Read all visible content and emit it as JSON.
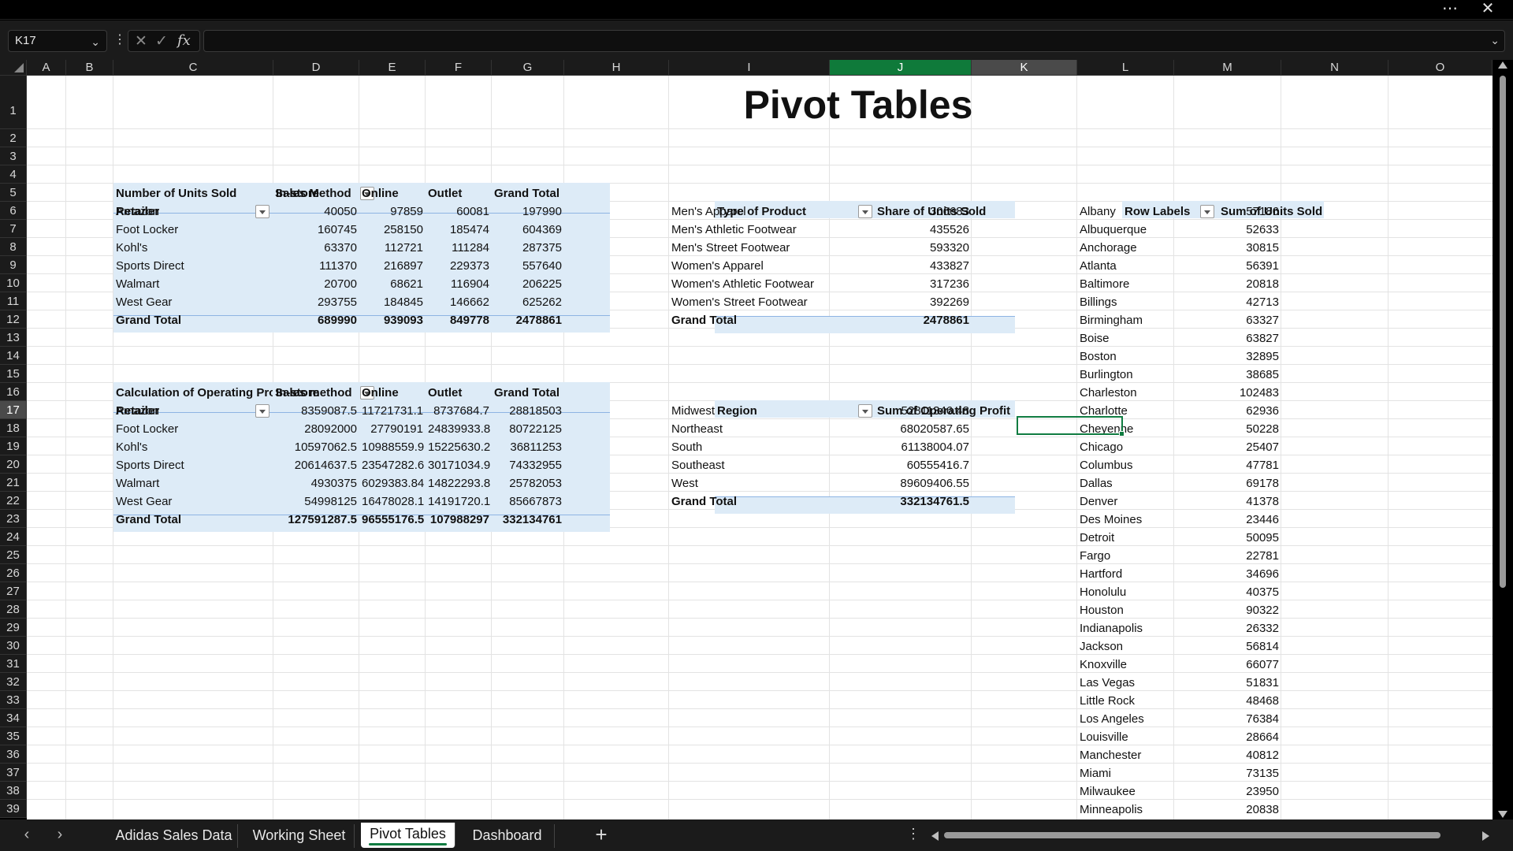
{
  "window": {
    "more_icon": "ellipsis-icon",
    "close_icon": "close-icon"
  },
  "formula_bar": {
    "name_box": "K17",
    "formula": "",
    "fx_label": "fx"
  },
  "columns": [
    "A",
    "B",
    "C",
    "D",
    "E",
    "F",
    "G",
    "H",
    "I",
    "J",
    "K",
    "L",
    "M",
    "N",
    "O"
  ],
  "rows": [
    "1",
    "2",
    "3",
    "4",
    "5",
    "6",
    "7",
    "8",
    "9",
    "10",
    "11",
    "12",
    "13",
    "14",
    "15",
    "16",
    "17",
    "18",
    "19",
    "20",
    "21",
    "22",
    "23",
    "24",
    "25",
    "26",
    "27",
    "28",
    "29",
    "30",
    "31",
    "32",
    "33",
    "34",
    "35",
    "36",
    "37",
    "38",
    "39"
  ],
  "title": "Pivot Tables",
  "units_pivot": {
    "corner": "Number of Units Sold",
    "col_field": "Sales Method",
    "row_field": "Retailer",
    "headers": [
      "In-store",
      "Online",
      "Outlet",
      "Grand Total"
    ],
    "rows": [
      {
        "label": "Amazon",
        "values": [
          "40050",
          "97859",
          "60081",
          "197990"
        ]
      },
      {
        "label": "Foot Locker",
        "values": [
          "160745",
          "258150",
          "185474",
          "604369"
        ]
      },
      {
        "label": "Kohl's",
        "values": [
          "63370",
          "112721",
          "111284",
          "287375"
        ]
      },
      {
        "label": "Sports Direct",
        "values": [
          "111370",
          "216897",
          "229373",
          "557640"
        ]
      },
      {
        "label": "Walmart",
        "values": [
          "20700",
          "68621",
          "116904",
          "206225"
        ]
      },
      {
        "label": "West Gear",
        "values": [
          "293755",
          "184845",
          "146662",
          "625262"
        ]
      }
    ],
    "total": {
      "label": "Grand Total",
      "values": [
        "689990",
        "939093",
        "849778",
        "2478861"
      ]
    }
  },
  "profit_pivot": {
    "corner": "Calculation of Operating Profit",
    "col_field": "Sales method",
    "row_field": "Retailer",
    "headers": [
      "In-store",
      "Online",
      "Outlet",
      "Grand Total"
    ],
    "rows": [
      {
        "label": "Amazon",
        "values": [
          "8359087.5",
          "11721731.1",
          "8737684.7",
          "28818503"
        ]
      },
      {
        "label": "Foot Locker",
        "values": [
          "28092000",
          "27790191",
          "24839933.8",
          "80722125"
        ]
      },
      {
        "label": "Kohl's",
        "values": [
          "10597062.5",
          "10988559.9",
          "15225630.2",
          "36811253"
        ]
      },
      {
        "label": "Sports Direct",
        "values": [
          "20614637.5",
          "23547282.6",
          "30171034.9",
          "74332955"
        ]
      },
      {
        "label": "Walmart",
        "values": [
          "4930375",
          "6029383.84",
          "14822293.8",
          "25782053"
        ]
      },
      {
        "label": "West Gear",
        "values": [
          "54998125",
          "16478028.1",
          "14191720.1",
          "85667873"
        ]
      }
    ],
    "total": {
      "label": "Grand Total",
      "values": [
        "127591287.5",
        "96555176.5",
        "107988297",
        "332134761"
      ]
    }
  },
  "product_pivot": {
    "h1": "Type of Product",
    "h2": "Share of Units Sold",
    "rows": [
      {
        "label": "Men's Apparel",
        "value": "306683"
      },
      {
        "label": "Men's Athletic Footwear",
        "value": "435526"
      },
      {
        "label": "Men's Street Footwear",
        "value": "593320"
      },
      {
        "label": "Women's Apparel",
        "value": "433827"
      },
      {
        "label": "Women's Athletic Footwear",
        "value": "317236"
      },
      {
        "label": "Women's Street Footwear",
        "value": "392269"
      }
    ],
    "total": {
      "label": "Grand Total",
      "value": "2478861"
    }
  },
  "region_pivot": {
    "h1": "Region",
    "h2": "Sum of Operating Profit",
    "rows": [
      {
        "label": "Midwest",
        "value": "52811346.48"
      },
      {
        "label": "Northeast",
        "value": "68020587.65"
      },
      {
        "label": "South",
        "value": "61138004.07"
      },
      {
        "label": "Southeast",
        "value": "60555416.7"
      },
      {
        "label": "West",
        "value": "89609406.55"
      }
    ],
    "total": {
      "label": "Grand Total",
      "value": "332134761.5"
    }
  },
  "city_pivot": {
    "h1": "Row Labels",
    "h2": "Sum of Units Sold",
    "rows": [
      {
        "label": "Albany",
        "value": "57186"
      },
      {
        "label": "Albuquerque",
        "value": "52633"
      },
      {
        "label": "Anchorage",
        "value": "30815"
      },
      {
        "label": "Atlanta",
        "value": "56391"
      },
      {
        "label": "Baltimore",
        "value": "20818"
      },
      {
        "label": "Billings",
        "value": "42713"
      },
      {
        "label": "Birmingham",
        "value": "63327"
      },
      {
        "label": "Boise",
        "value": "63827"
      },
      {
        "label": "Boston",
        "value": "32895"
      },
      {
        "label": "Burlington",
        "value": "38685"
      },
      {
        "label": "Charleston",
        "value": "102483"
      },
      {
        "label": "Charlotte",
        "value": "62936"
      },
      {
        "label": "Cheyenne",
        "value": "50228"
      },
      {
        "label": "Chicago",
        "value": "25407"
      },
      {
        "label": "Columbus",
        "value": "47781"
      },
      {
        "label": "Dallas",
        "value": "69178"
      },
      {
        "label": "Denver",
        "value": "41378"
      },
      {
        "label": "Des Moines",
        "value": "23446"
      },
      {
        "label": "Detroit",
        "value": "50095"
      },
      {
        "label": "Fargo",
        "value": "22781"
      },
      {
        "label": "Hartford",
        "value": "34696"
      },
      {
        "label": "Honolulu",
        "value": "40375"
      },
      {
        "label": "Houston",
        "value": "90322"
      },
      {
        "label": "Indianapolis",
        "value": "26332"
      },
      {
        "label": "Jackson",
        "value": "56814"
      },
      {
        "label": "Knoxville",
        "value": "66077"
      },
      {
        "label": "Las Vegas",
        "value": "51831"
      },
      {
        "label": "Little Rock",
        "value": "48468"
      },
      {
        "label": "Los Angeles",
        "value": "76384"
      },
      {
        "label": "Louisville",
        "value": "28664"
      },
      {
        "label": "Manchester",
        "value": "40812"
      },
      {
        "label": "Miami",
        "value": "73135"
      },
      {
        "label": "Milwaukee",
        "value": "23950"
      },
      {
        "label": "Minneapolis",
        "value": "20838"
      }
    ]
  },
  "sheet_tabs": {
    "tabs": [
      "Adidas Sales Data",
      "Working Sheet",
      "Pivot Tables",
      "Dashboard"
    ],
    "active": "Pivot Tables",
    "add_label": "+"
  },
  "colors": {
    "selected_header": "#0f7a3a",
    "pivot_band": "#ddebf7",
    "active_cell": "#107c41"
  }
}
